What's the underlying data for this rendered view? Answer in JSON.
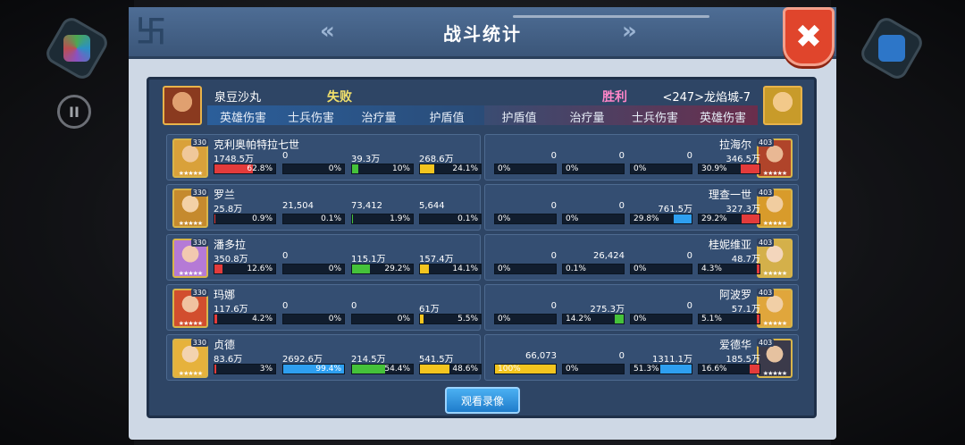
{
  "title": "战斗统计",
  "close_symbol": "✖",
  "pause_symbol": "II",
  "replay_label": "观看录像",
  "left_player": {
    "name": "泉豆沙丸",
    "result": "失败"
  },
  "right_player": {
    "name": "<247>龙焰城-7",
    "result": "胜利"
  },
  "headers_left": [
    "英雄伤害",
    "士兵伤害",
    "治疗量",
    "护盾值"
  ],
  "headers_right": [
    "护盾值",
    "治疗量",
    "士兵伤害",
    "英雄伤害"
  ],
  "colors": {
    "hero_damage": "#e33b3b",
    "soldier_damage": "#2e9ff0",
    "healing": "#45c23a",
    "shield": "#f3c51f"
  },
  "left_heroes": [
    {
      "name": "克利奥帕特拉七世",
      "level": "330",
      "stars": "★★★★★",
      "stats": [
        {
          "value": "1748.5万",
          "pct": "62.8%",
          "fill": 62.8
        },
        {
          "value": "0",
          "pct": "0%",
          "fill": 0
        },
        {
          "value": "39.3万",
          "pct": "10%",
          "fill": 10
        },
        {
          "value": "268.6万",
          "pct": "24.1%",
          "fill": 24.1
        }
      ]
    },
    {
      "name": "罗兰",
      "level": "330",
      "stars": "★★★★★",
      "stats": [
        {
          "value": "25.8万",
          "pct": "0.9%",
          "fill": 0.9
        },
        {
          "value": "21,504",
          "pct": "0.1%",
          "fill": 0.1
        },
        {
          "value": "73,412",
          "pct": "1.9%",
          "fill": 1.9
        },
        {
          "value": "5,644",
          "pct": "0.1%",
          "fill": 0.1
        }
      ]
    },
    {
      "name": "潘多拉",
      "level": "330",
      "stars": "★★★★★",
      "stats": [
        {
          "value": "350.8万",
          "pct": "12.6%",
          "fill": 12.6
        },
        {
          "value": "0",
          "pct": "0%",
          "fill": 0
        },
        {
          "value": "115.1万",
          "pct": "29.2%",
          "fill": 29.2
        },
        {
          "value": "157.4万",
          "pct": "14.1%",
          "fill": 14.1
        }
      ]
    },
    {
      "name": "玛娜",
      "level": "330",
      "stars": "★★★★★",
      "stats": [
        {
          "value": "117.6万",
          "pct": "4.2%",
          "fill": 4.2
        },
        {
          "value": "0",
          "pct": "0%",
          "fill": 0
        },
        {
          "value": "0",
          "pct": "0%",
          "fill": 0
        },
        {
          "value": "61万",
          "pct": "5.5%",
          "fill": 5.5
        }
      ]
    },
    {
      "name": "贞德",
      "level": "330",
      "stars": "★★★★★",
      "stats": [
        {
          "value": "83.6万",
          "pct": "3%",
          "fill": 3
        },
        {
          "value": "2692.6万",
          "pct": "99.4%",
          "fill": 99.4
        },
        {
          "value": "214.5万",
          "pct": "54.4%",
          "fill": 54.4
        },
        {
          "value": "541.5万",
          "pct": "48.6%",
          "fill": 48.6
        }
      ]
    }
  ],
  "right_heroes": [
    {
      "name": "拉海尔",
      "level": "403",
      "stars": "★★★★★",
      "stats": [
        {
          "value": "0",
          "pct": "0%",
          "fill": 0
        },
        {
          "value": "0",
          "pct": "0%",
          "fill": 0
        },
        {
          "value": "0",
          "pct": "0%",
          "fill": 0
        },
        {
          "value": "346.5万",
          "pct": "30.9%",
          "fill": 30.9
        }
      ]
    },
    {
      "name": "理查一世",
      "level": "403",
      "stars": "★★★★★",
      "stats": [
        {
          "value": "0",
          "pct": "0%",
          "fill": 0
        },
        {
          "value": "0",
          "pct": "0%",
          "fill": 0
        },
        {
          "value": "761.5万",
          "pct": "29.8%",
          "fill": 29.8
        },
        {
          "value": "327.3万",
          "pct": "29.2%",
          "fill": 29.2
        }
      ]
    },
    {
      "name": "桂妮维亚",
      "level": "403",
      "stars": "★★★★★",
      "stats": [
        {
          "value": "0",
          "pct": "0%",
          "fill": 0
        },
        {
          "value": "26,424",
          "pct": "0.1%",
          "fill": 0.1
        },
        {
          "value": "0",
          "pct": "0%",
          "fill": 0
        },
        {
          "value": "48.7万",
          "pct": "4.3%",
          "fill": 4.3
        }
      ]
    },
    {
      "name": "阿波罗",
      "level": "403",
      "stars": "★★★★★",
      "stats": [
        {
          "value": "0",
          "pct": "0%",
          "fill": 0
        },
        {
          "value": "275.3万",
          "pct": "14.2%",
          "fill": 14.2
        },
        {
          "value": "0",
          "pct": "0%",
          "fill": 0
        },
        {
          "value": "57.1万",
          "pct": "5.1%",
          "fill": 5.1
        }
      ]
    },
    {
      "name": "爱德华",
      "level": "403",
      "stars": "★★★★★",
      "stats": [
        {
          "value": "66,073",
          "pct": "100%",
          "fill": 100
        },
        {
          "value": "0",
          "pct": "0%",
          "fill": 0
        },
        {
          "value": "1311.1万",
          "pct": "51.3%",
          "fill": 51.3
        },
        {
          "value": "185.5万",
          "pct": "16.6%",
          "fill": 16.6
        }
      ]
    }
  ]
}
